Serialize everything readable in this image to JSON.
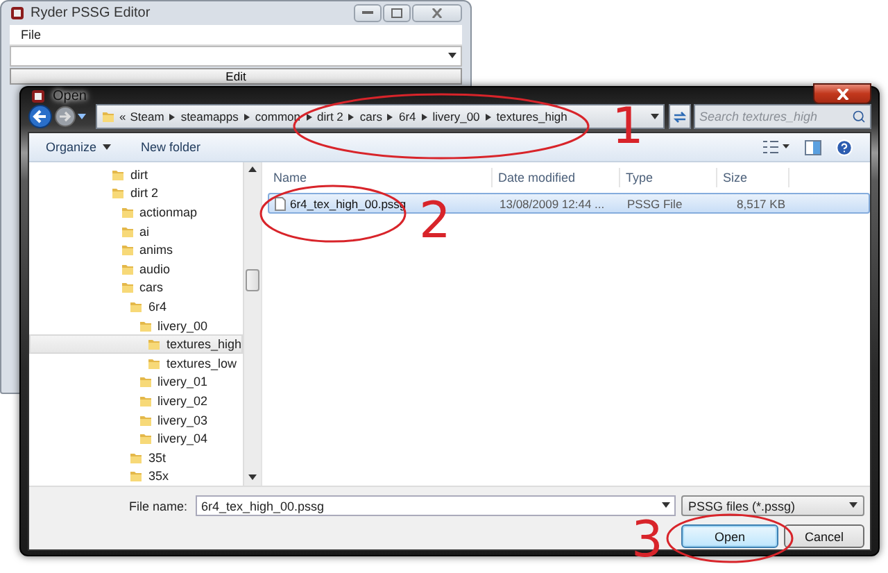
{
  "back_window": {
    "title": "Ryder PSSG Editor",
    "menu": [
      "File"
    ],
    "button": "Edit"
  },
  "dialog": {
    "title": "Open",
    "breadcrumb_overflow": "«",
    "breadcrumb": [
      "Steam",
      "steamapps",
      "common",
      "dirt 2",
      "cars",
      "6r4",
      "livery_00",
      "textures_high"
    ],
    "search": {
      "placeholder": "Search textures_high"
    },
    "toolbar": [
      {
        "label": "Organize",
        "dropdown": true
      },
      {
        "label": "New folder",
        "dropdown": false
      }
    ],
    "tree": [
      {
        "label": "dirt",
        "selected": false
      },
      {
        "label": "dirt 2",
        "selected": false,
        "children": [
          {
            "label": "actionmap",
            "selected": false
          },
          {
            "label": "ai",
            "selected": false
          },
          {
            "label": "anims",
            "selected": false
          },
          {
            "label": "audio",
            "selected": false
          },
          {
            "label": "cars",
            "selected": false,
            "children": [
              {
                "label": "6r4",
                "selected": false,
                "children": [
                  {
                    "label": "livery_00",
                    "selected": false,
                    "children": [
                      {
                        "label": "textures_high",
                        "selected": true
                      },
                      {
                        "label": "textures_low",
                        "selected": false
                      }
                    ]
                  },
                  {
                    "label": "livery_01",
                    "selected": false
                  },
                  {
                    "label": "livery_02",
                    "selected": false
                  },
                  {
                    "label": "livery_03",
                    "selected": false
                  },
                  {
                    "label": "livery_04",
                    "selected": false
                  }
                ]
              },
              {
                "label": "35t",
                "selected": false
              },
              {
                "label": "35x",
                "selected": false
              }
            ]
          }
        ]
      }
    ],
    "columns": [
      "Name",
      "Date modified",
      "Type",
      "Size"
    ],
    "files": [
      {
        "name": "6r4_tex_high_00.pssg",
        "date": "13/08/2009 12:44 ...",
        "type": "PSSG File",
        "size": "8,517 KB",
        "selected": true
      }
    ],
    "file_name": {
      "label": "File name:",
      "value": "6r4_tex_high_00.pssg"
    },
    "filter": "PSSG files (*.pssg)",
    "buttons": [
      {
        "label": "Open",
        "default": true
      },
      {
        "label": "Cancel",
        "default": false
      }
    ]
  },
  "annotations": [
    {
      "label": "1"
    },
    {
      "label": "2"
    },
    {
      "label": "3"
    }
  ]
}
